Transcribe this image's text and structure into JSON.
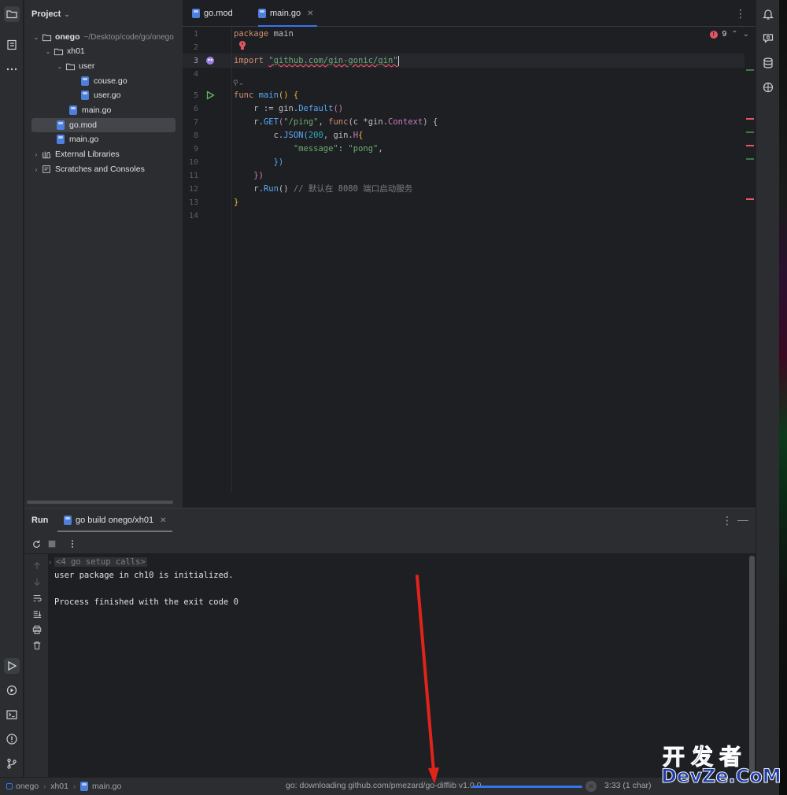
{
  "project_panel": {
    "title": "Project",
    "tree": [
      {
        "label": "onego",
        "path": "~/Desktop/code/go/onego"
      },
      {
        "label": "xh01"
      },
      {
        "label": "user"
      },
      {
        "label": "couse.go"
      },
      {
        "label": "user.go"
      },
      {
        "label": "main.go"
      },
      {
        "label": "go.mod"
      },
      {
        "label": "main.go"
      },
      {
        "label": "External Libraries"
      },
      {
        "label": "Scratches and Consoles"
      }
    ]
  },
  "editor": {
    "tabs": [
      {
        "label": "go.mod"
      },
      {
        "label": "main.go"
      }
    ],
    "error_count": "9",
    "line_numbers": [
      "1",
      "2",
      "3",
      "4",
      "5",
      "6",
      "7",
      "8",
      "9",
      "10",
      "11",
      "12",
      "13",
      "14"
    ],
    "code": {
      "l1_kw": "package",
      "l1_rest": " main",
      "l3_kw": "import",
      "l3_str": "\"github.com/gin-gonic/gin\"",
      "l5_kw": "func",
      "l5_fn": "main",
      "l5_rest": "() {",
      "l6": "    r := gin.",
      "l6_fn": "Default",
      "l6_end": "()",
      "l7_a": "    r.",
      "l7_fn": "GET",
      "l7_str": "\"/ping\"",
      "l7_b": ", ",
      "l7_kw": "func",
      "l7_c": "(c *gin.",
      "l7_typ": "Context",
      "l7_d": ") {",
      "l8_a": "        c.",
      "l8_fn": "JSON",
      "l8_num": "200",
      "l8_b": ", gin.",
      "l8_typ": "H",
      "l8_c": "{",
      "l9_str1": "\"message\"",
      "l9_sep": ": ",
      "l9_str2": "\"pong\"",
      "l9_end": ",",
      "l10": "        })",
      "l11": "    })",
      "l12_a": "    r.",
      "l12_fn": "Run",
      "l12_b": "() ",
      "l12_cmt": "// 默认在 8080 端口启动服务",
      "l13": "}"
    }
  },
  "run_panel": {
    "title": "Run",
    "tab_label": "go build onego/xh01",
    "console": [
      "<4 go setup calls>",
      "user package in ch10 is initialized.",
      "",
      "Process finished with the exit code 0"
    ]
  },
  "statusbar": {
    "breadcrumbs": [
      "onego",
      "xh01",
      "main.go"
    ],
    "task": "go: downloading github.com/pmezard/go-difflib v1.0.0",
    "progress": 1.0,
    "position": "3:33 (1 char)"
  },
  "watermark": {
    "line1": "开发者",
    "line2": "DevZe.CoM"
  },
  "colors": {
    "accent": "#3574f0",
    "annotation_arrow": "#e0241b"
  }
}
